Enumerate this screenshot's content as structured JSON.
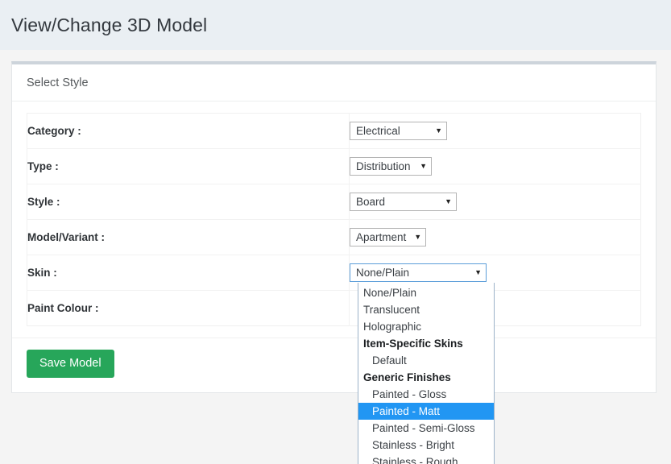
{
  "page": {
    "title": "View/Change 3D Model",
    "header_bg": "#eaeff3",
    "body_bg": "#f4f4f4"
  },
  "card": {
    "header_title": "Select Style",
    "top_border_color": "#cdd4db"
  },
  "form": {
    "rows": [
      {
        "label": "Category :",
        "value": "Electrical",
        "control": "select"
      },
      {
        "label": "Type :",
        "value": "Distribution",
        "control": "select"
      },
      {
        "label": "Style :",
        "value": "Board",
        "control": "select"
      },
      {
        "label": "Model/Variant :",
        "value": "Apartment",
        "control": "select"
      },
      {
        "label": "Skin :",
        "value": "None/Plain",
        "control": "select-open"
      },
      {
        "label": "Paint Colour :",
        "value": "",
        "control": "none"
      }
    ]
  },
  "skin_dropdown": {
    "selected_value": "None/Plain",
    "highlighted_option": "Painted - Matt",
    "highlight_color": "#2196f3",
    "focus_border_color": "#5b9dd9",
    "options": [
      {
        "label": "None/Plain",
        "type": "option",
        "selected": false
      },
      {
        "label": "Translucent",
        "type": "option",
        "selected": false
      },
      {
        "label": "Holographic",
        "type": "option",
        "selected": false
      },
      {
        "label": "Item-Specific Skins",
        "type": "group",
        "selected": false
      },
      {
        "label": "Default",
        "type": "option",
        "selected": false
      },
      {
        "label": "Generic Finishes",
        "type": "group",
        "selected": false
      },
      {
        "label": "Painted - Gloss",
        "type": "option",
        "selected": false
      },
      {
        "label": "Painted - Matt",
        "type": "option",
        "selected": true
      },
      {
        "label": "Painted - Semi-Gloss",
        "type": "option",
        "selected": false
      },
      {
        "label": "Stainless - Bright",
        "type": "option",
        "selected": false
      },
      {
        "label": "Stainless - Rough",
        "type": "option",
        "selected": false
      }
    ]
  },
  "footer": {
    "save_label": "Save Model",
    "save_color": "#27a65a"
  },
  "icons": {
    "caret_down": "▼"
  }
}
